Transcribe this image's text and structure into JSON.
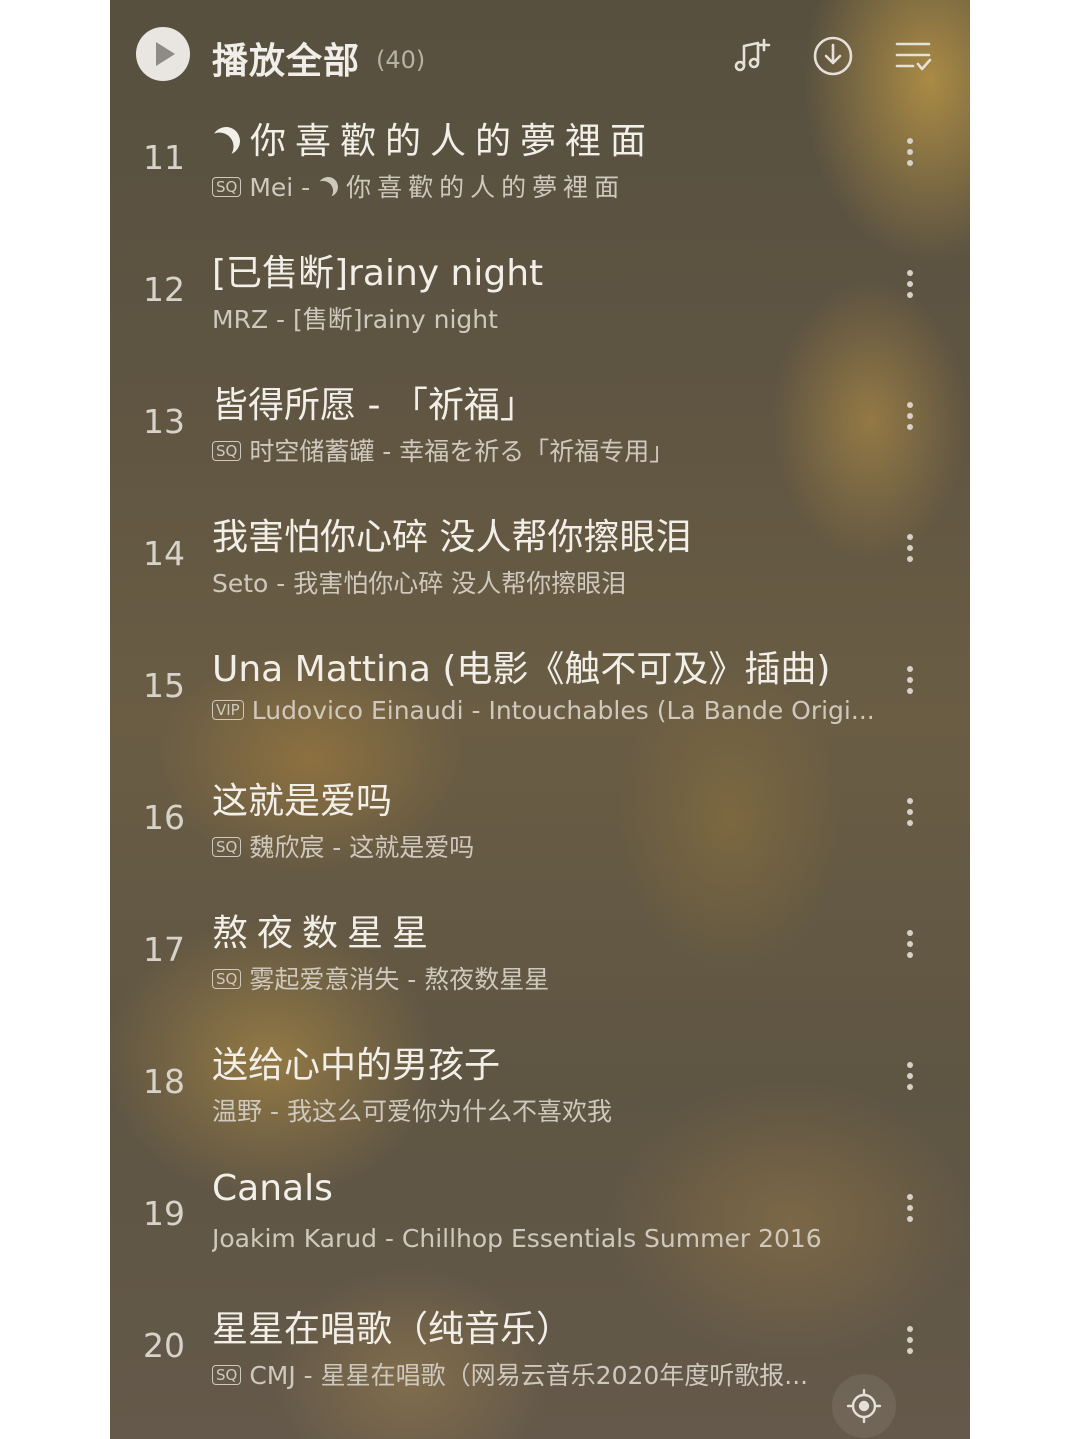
{
  "header": {
    "title": "播放全部",
    "count": "(40)",
    "icons": [
      "play-circle-icon",
      "add-music-icon",
      "download-icon",
      "multi-select-icon"
    ]
  },
  "songs": [
    {
      "index": "11",
      "title": "你喜歡的人的夢裡面",
      "title_prefix_icon": "moon-icon",
      "badge": "SQ",
      "artist": "Mei",
      "album": "你喜歡的人的夢裡面",
      "album_prefix_icon": "moon-icon"
    },
    {
      "index": "12",
      "title": "[已售断]rainy night",
      "badge": "",
      "artist": "MRZ",
      "album": "[售断]rainy night"
    },
    {
      "index": "13",
      "title": "皆得所愿 - 「祈福」",
      "badge": "SQ",
      "artist": "时空储蓄罐",
      "album": "幸福を祈る「祈福专用」"
    },
    {
      "index": "14",
      "title": "我害怕你心碎 没人帮你擦眼泪",
      "badge": "",
      "artist": "Seto",
      "album": "我害怕你心碎 没人帮你擦眼泪"
    },
    {
      "index": "15",
      "title": "Una Mattina (电影《触不可及》插曲)",
      "badge": "VIP",
      "artist": "Ludovico Einaudi",
      "album": "Intouchables (La Bande Origi..."
    },
    {
      "index": "16",
      "title": "这就是爱吗",
      "badge": "SQ",
      "artist": "魏欣宸",
      "album": "这就是爱吗"
    },
    {
      "index": "17",
      "title": "熬夜数星星",
      "badge": "SQ",
      "artist": "雾起爱意消失",
      "album": "熬夜数星星"
    },
    {
      "index": "18",
      "title": "送给心中的男孩子",
      "badge": "",
      "artist": "温野",
      "album": "我这么可爱你为什么不喜欢我"
    },
    {
      "index": "19",
      "title": "Canals",
      "badge": "",
      "artist": "Joakim Karud",
      "album": "Chillhop Essentials Summer 2016"
    },
    {
      "index": "20",
      "title": "星星在唱歌（纯音乐）",
      "badge": "SQ",
      "artist": "CMJ",
      "album": "星星在唱歌（网易云音乐2020年度听歌报..."
    }
  ],
  "separator": " - ",
  "floating": {
    "icon": "locate-icon"
  }
}
